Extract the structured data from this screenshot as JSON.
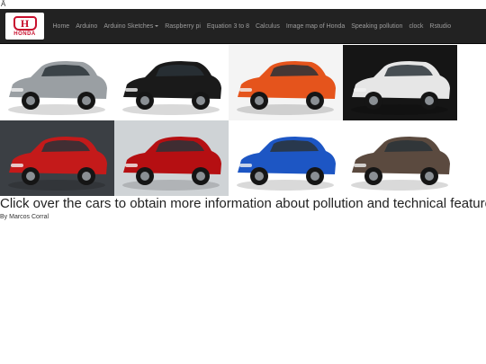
{
  "stray_char": "Â",
  "brand": {
    "mark": "H",
    "word": "HONDA"
  },
  "nav": {
    "items": [
      {
        "label": "Home"
      },
      {
        "label": "Arduino"
      },
      {
        "label": "Arduino Sketches",
        "dropdown": true
      },
      {
        "label": "Raspberry pi"
      },
      {
        "label": "Equation 3 to 8"
      },
      {
        "label": "Calculus"
      },
      {
        "label": "Image map of Honda"
      },
      {
        "label": "Speaking pollution"
      },
      {
        "label": "clock"
      },
      {
        "label": "Rstudio"
      }
    ]
  },
  "cars": [
    {
      "name": "car-hrv-silver",
      "body": "#9a9fa3",
      "bg": "#ffffff"
    },
    {
      "name": "car-honda-e-black",
      "body": "#1a1a1a",
      "bg": "#ffffff"
    },
    {
      "name": "car-jazz-orange",
      "body": "#e5541c",
      "bg": "#f4f4f4"
    },
    {
      "name": "car-civic-type-r-white",
      "body": "#e6e6e6",
      "bg": "#151515"
    },
    {
      "name": "car-civic-hatch-red",
      "body": "#c41a1a",
      "bg": "#3b3f44"
    },
    {
      "name": "car-nsx-red",
      "body": "#b50f12",
      "bg": "#cfd3d6"
    },
    {
      "name": "car-civic-sedan-blue",
      "body": "#1d56c4",
      "bg": "#ffffff"
    },
    {
      "name": "car-crv-brown",
      "body": "#5b4a3f",
      "bg": "#ffffff"
    }
  ],
  "caption": "Click over the cars to obtain more information about pollution and technical features",
  "byline": "By Marcos Corral"
}
